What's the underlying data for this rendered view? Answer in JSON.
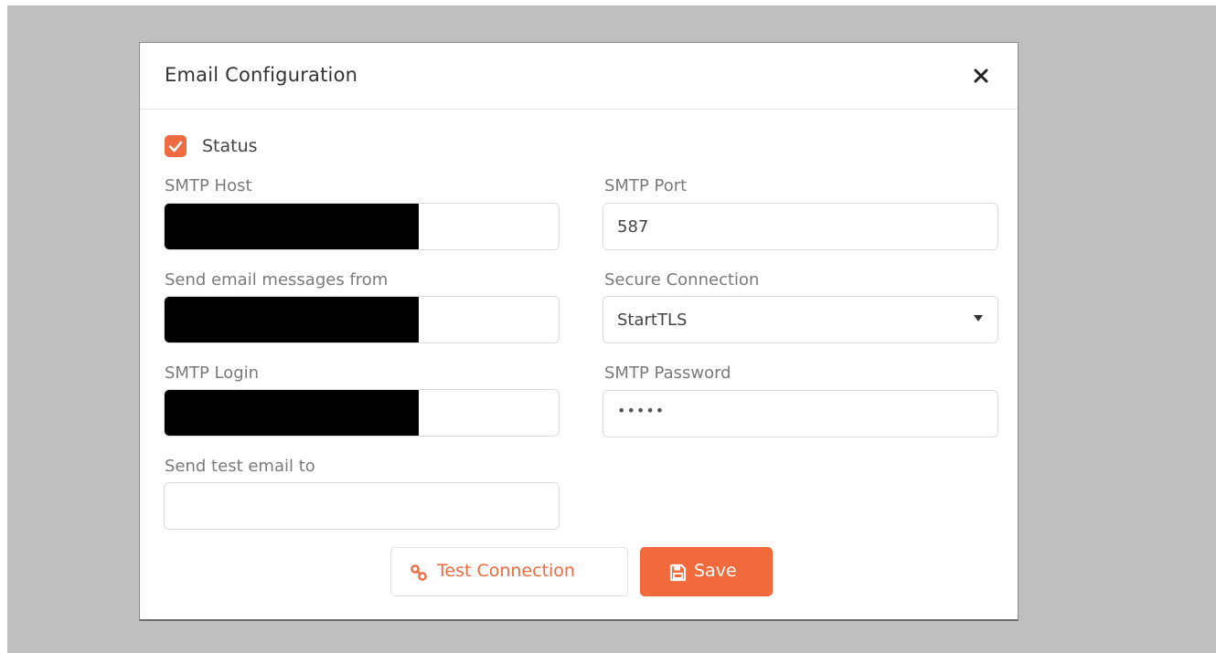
{
  "modal": {
    "title": "Email Configuration",
    "close_icon": "close-icon"
  },
  "status": {
    "label": "Status",
    "checked": true
  },
  "fields": {
    "smtp_host": {
      "label": "SMTP Host",
      "value": "",
      "redacted": true
    },
    "smtp_port": {
      "label": "SMTP Port",
      "value": "587"
    },
    "send_from": {
      "label": "Send email messages from",
      "value": "",
      "redacted": true
    },
    "secure_connection": {
      "label": "Secure Connection",
      "value": "StartTLS"
    },
    "smtp_login": {
      "label": "SMTP Login",
      "value": "",
      "redacted": true
    },
    "smtp_password": {
      "label": "SMTP Password",
      "value": "•••••"
    },
    "send_test_to": {
      "label": "Send test email to",
      "value": ""
    }
  },
  "buttons": {
    "test_connection": {
      "label": "Test Connection",
      "icon": "link-icon"
    },
    "save": {
      "label": "Save",
      "icon": "floppy-disk-icon"
    }
  },
  "colors": {
    "accent": "#f06a3b",
    "backdrop": "#bfbfbf"
  }
}
